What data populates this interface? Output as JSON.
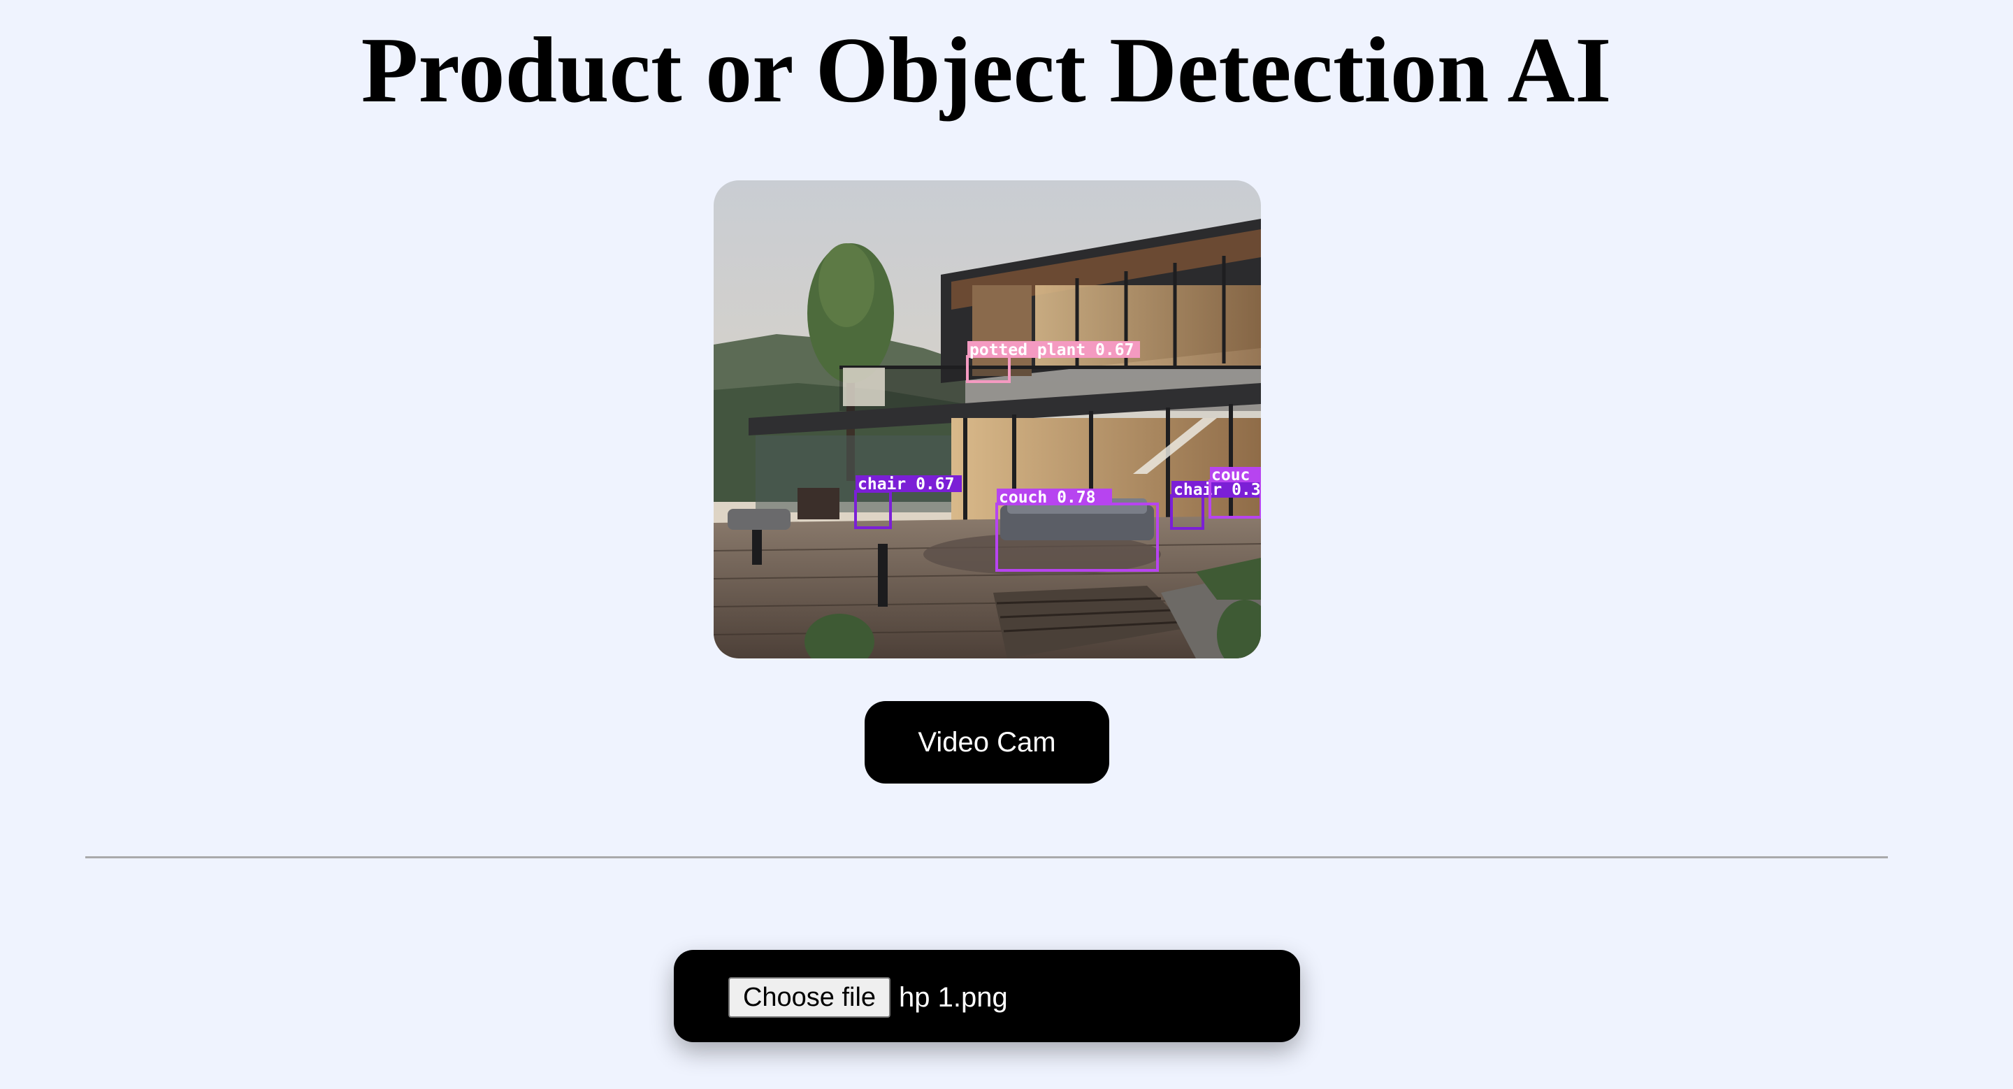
{
  "page": {
    "title": "Product or Object Detection AI"
  },
  "result_image": {
    "description_icon": "detection-result-image",
    "detections": [
      {
        "label": "potted plant 0.67",
        "color": "#f49ac1"
      },
      {
        "label": "chair 0.67",
        "color": "#7b1fd6"
      },
      {
        "label": "couch 0.78",
        "color": "#b744f0"
      },
      {
        "label": "chair 0.3",
        "color": "#7b1fd6"
      },
      {
        "label": "couc",
        "color": "#b744f0"
      }
    ]
  },
  "controls": {
    "video_cam_label": "Video Cam",
    "choose_file_label": "Choose file",
    "file_name": "hp 1.png"
  },
  "colors": {
    "background": "#eff3fe",
    "button_bg": "#000000",
    "button_text": "#ffffff",
    "divider": "#a9a9ab"
  }
}
